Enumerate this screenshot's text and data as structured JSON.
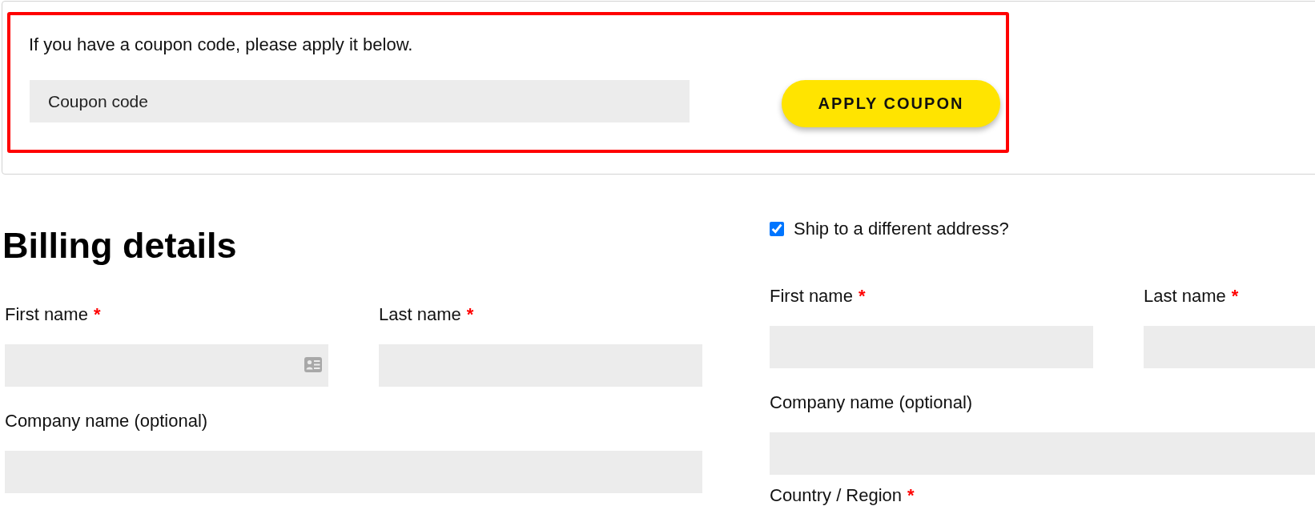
{
  "coupon_panel": {
    "highlighted": true,
    "prompt": "If you have a coupon code, please apply it below.",
    "coupon_field": {
      "placeholder": "Coupon code"
    },
    "apply_button": "APPLY COUPON"
  },
  "billing": {
    "title": "Billing details",
    "fields": [
      {
        "label": "First name",
        "required_mark": "*",
        "kind": "half",
        "autofill_icon": true
      },
      {
        "label": "Last name",
        "required_mark": "*",
        "kind": "half"
      },
      {
        "label": "Company name (optional)",
        "kind": "full"
      }
    ]
  },
  "shipping": {
    "ship_to_different_address": {
      "label": "Ship to a different address?",
      "checked": true
    },
    "fields": [
      {
        "label": "First name",
        "required_mark": "*",
        "kind": "half"
      },
      {
        "label": "Last name",
        "required_mark": "*",
        "kind": "half"
      },
      {
        "label": "Company name (optional)",
        "kind": "full"
      },
      {
        "label": "Country / Region",
        "required_mark": "*",
        "kind": "label_only"
      }
    ]
  }
}
